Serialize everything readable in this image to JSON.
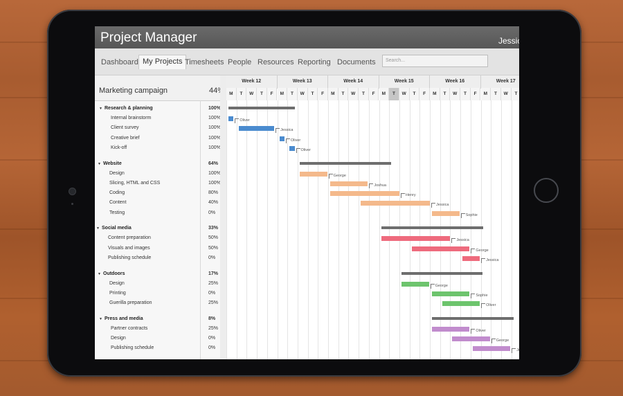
{
  "app": {
    "title": "Project Manager",
    "user": "Jessica"
  },
  "nav": {
    "items": [
      {
        "label": "Dashboard",
        "active": false
      },
      {
        "label": "My Projects",
        "active": true
      },
      {
        "label": "Timesheets",
        "active": false
      },
      {
        "label": "People",
        "active": false
      },
      {
        "label": "Resources",
        "active": false
      },
      {
        "label": "Reporting",
        "active": false
      },
      {
        "label": "Documents",
        "active": false
      }
    ],
    "search_placeholder": "Search..."
  },
  "project": {
    "name": "Marketing campaign",
    "progress": "44%"
  },
  "weeks": [
    "Week 12",
    "Week 13",
    "Week 14",
    "Week 15",
    "Week 16",
    "Week 17"
  ],
  "day_letters": [
    "M",
    "T",
    "W",
    "T",
    "F"
  ],
  "today": {
    "week": "Week 15",
    "day_index": 1
  },
  "colors": {
    "research": "#4a8bcf",
    "website": "#f4b98b",
    "social": "#ee6b7d",
    "outdoors": "#6dc46d",
    "press": "#c18ccd",
    "group": "#6e6e6e"
  },
  "groups": [
    {
      "name": "Research & planning",
      "progress": "100%",
      "color_key": "research",
      "span": [
        0,
        6.5
      ],
      "tasks": [
        {
          "name": "Internal brainstorm",
          "progress": "100%",
          "start": 0,
          "days": 0.5,
          "assignee": "Oliver"
        },
        {
          "name": "Client survey",
          "progress": "100%",
          "start": 1,
          "days": 3.5,
          "assignee": "Jessica"
        },
        {
          "name": "Creative brief",
          "progress": "100%",
          "start": 5,
          "days": 0.5,
          "assignee": "Oliver"
        },
        {
          "name": "Kick-off",
          "progress": "100%",
          "start": 6,
          "days": 0.5,
          "assignee": "Oliver"
        }
      ]
    },
    {
      "name": "Website",
      "progress": "64%",
      "color_key": "website",
      "span": [
        7,
        16
      ],
      "tasks": [
        {
          "name": "Design",
          "progress": "100%",
          "start": 7,
          "days": 2.7,
          "assignee": "George"
        },
        {
          "name": "Slicing, HTML and CSS",
          "progress": "100%",
          "start": 10,
          "days": 3.7,
          "assignee": "Joshua"
        },
        {
          "name": "Coding",
          "progress": "80%",
          "start": 10,
          "days": 6.8,
          "assignee": "Henry"
        },
        {
          "name": "Content",
          "progress": "40%",
          "start": 13,
          "days": 6.8,
          "assignee": "Jessica"
        },
        {
          "name": "Testing",
          "progress": "0%",
          "start": 20,
          "days": 2.7,
          "assignee": "Sophie"
        }
      ]
    },
    {
      "name": "Social media",
      "progress": "33%",
      "color_key": "social",
      "span": [
        15,
        25
      ],
      "tasks": [
        {
          "name": "Content preparation",
          "progress": "50%",
          "start": 15,
          "days": 6.8,
          "assignee": "Jessica"
        },
        {
          "name": "Visuals and images",
          "progress": "50%",
          "start": 18,
          "days": 5.7,
          "assignee": "George"
        },
        {
          "name": "Publishing schedule",
          "progress": "0%",
          "start": 23,
          "days": 1.7,
          "assignee": "Jessica"
        }
      ]
    },
    {
      "name": "Outdoors",
      "progress": "17%",
      "color_key": "outdoors",
      "span": [
        17,
        25
      ],
      "tasks": [
        {
          "name": "Design",
          "progress": "25%",
          "start": 17,
          "days": 2.7,
          "assignee": "George"
        },
        {
          "name": "Printing",
          "progress": "0%",
          "start": 20,
          "days": 3.7,
          "assignee": "Sophie"
        },
        {
          "name": "Guerilla preparation",
          "progress": "25%",
          "start": 21,
          "days": 3.7,
          "assignee": "Oliver"
        }
      ]
    },
    {
      "name": "Press and media",
      "progress": "8%",
      "color_key": "press",
      "span": [
        20,
        28
      ],
      "tasks": [
        {
          "name": "Partner contracts",
          "progress": "25%",
          "start": 20,
          "days": 3.7,
          "assignee": "Oliver"
        },
        {
          "name": "Design",
          "progress": "0%",
          "start": 22,
          "days": 3.7,
          "assignee": "George"
        },
        {
          "name": "Publishing schedule",
          "progress": "0%",
          "start": 24,
          "days": 3.7,
          "assignee": "Jessica"
        }
      ]
    }
  ]
}
